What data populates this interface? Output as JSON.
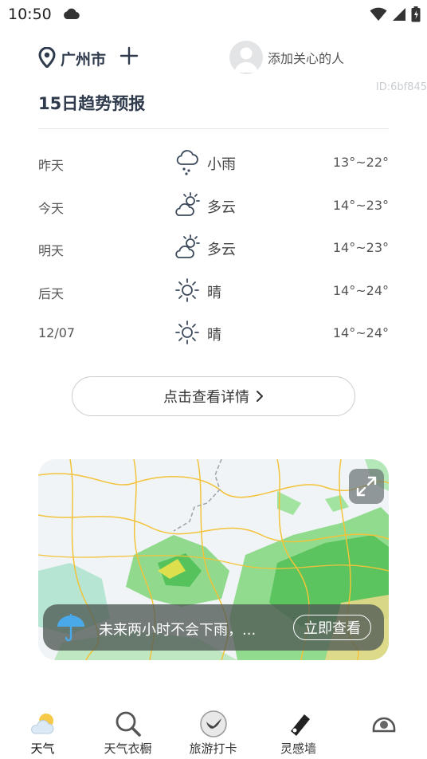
{
  "status_bar": {
    "time": "10:50"
  },
  "header": {
    "city": "广州市",
    "care_text": "添加关心的人",
    "id_badge": "ID:6bf845"
  },
  "section_title": "15日趋势预报",
  "forecast": [
    {
      "day": "昨天",
      "icon": "rain-cloud-icon",
      "desc": "小雨",
      "temp": "13°~22°"
    },
    {
      "day": "今天",
      "icon": "partly-cloudy-icon",
      "desc": "多云",
      "temp": "14°~23°"
    },
    {
      "day": "明天",
      "icon": "partly-cloudy-icon",
      "desc": "多云",
      "temp": "14°~23°"
    },
    {
      "day": "后天",
      "icon": "sun-icon",
      "desc": "晴",
      "temp": "14°~24°"
    },
    {
      "day": "12/07",
      "icon": "sun-icon",
      "desc": "晴",
      "temp": "14°~24°"
    }
  ],
  "detail_button": {
    "label": "点击查看详情"
  },
  "radar": {
    "banner_text": "未来两小时不会下雨，...",
    "view_now": "立即查看"
  },
  "tabs": [
    {
      "label": "天气",
      "icon": "weather-icon",
      "active": true
    },
    {
      "label": "天气衣橱",
      "icon": "wardrobe-search-icon",
      "active": false
    },
    {
      "label": "旅游打卡",
      "icon": "travel-bird-icon",
      "active": false
    },
    {
      "label": "灵感墙",
      "icon": "inspiration-tag-icon",
      "active": false
    },
    {
      "label": "",
      "icon": "helmet-icon",
      "active": false
    }
  ],
  "colors": {
    "title": "#2f3b4d",
    "divider": "#e6e8eb",
    "icon_stroke": "#3c4a5c",
    "rain_banner": "#4e5854"
  }
}
